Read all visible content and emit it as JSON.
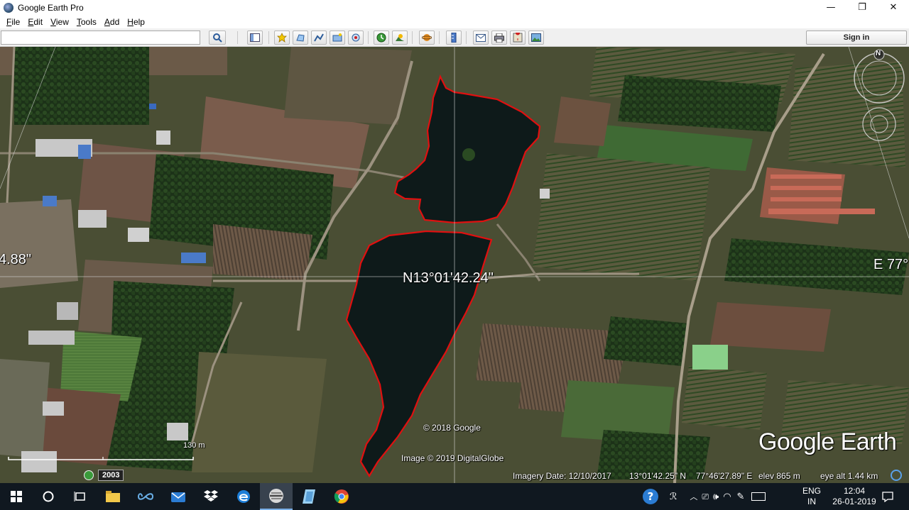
{
  "window": {
    "title": "Google Earth Pro",
    "minimize": "—",
    "restore": "❐",
    "close": "✕"
  },
  "menu": [
    "File",
    "Edit",
    "View",
    "Tools",
    "Add",
    "Help"
  ],
  "search": {
    "value": "",
    "placeholder": ""
  },
  "toolbar": {
    "sign_in_label": "Sign in"
  },
  "map": {
    "latitude_label": "N13°01'42.24\"",
    "longitude_edge_label": "E 77°",
    "latitude_edge_label": "4.88\"",
    "copyright_google": "© 2018 Google",
    "copyright_imagery": "Image © 2019 DigitalGlobe",
    "watermark": "Google Earth",
    "compass_north": "N",
    "scale_label": "130 m",
    "historical_year": "2003"
  },
  "status": {
    "imagery_date": "Imagery Date: 12/10/2017",
    "lat": "13°01'42.25\" N",
    "lon": "77°46'27.89\" E",
    "elev": "elev  865 m",
    "eye_alt": "eye alt  1.44 km"
  },
  "taskbar": {
    "language_top": "ENG",
    "language_bottom": "IN",
    "time": "12:04",
    "date": "26-01-2019"
  },
  "colors": {
    "polygon": "#e01010",
    "taskbar": "#101820",
    "water": "#0e1a1a"
  }
}
